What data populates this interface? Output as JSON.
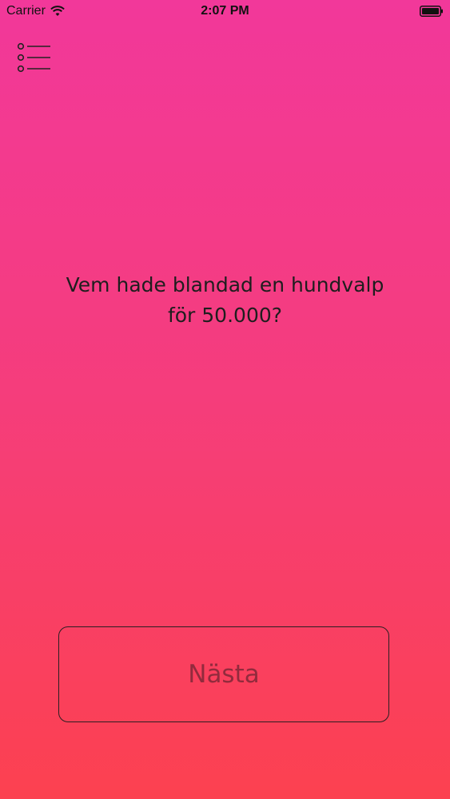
{
  "status_bar": {
    "carrier": "Carrier",
    "time": "2:07 PM",
    "wifi_icon": "wifi-icon",
    "battery_icon": "battery-icon"
  },
  "menu": {
    "icon": "list-menu-icon"
  },
  "question": {
    "line1": "Vem hade blandad en hundvalp",
    "line2": "för 50.000?"
  },
  "next_button": {
    "label": "Nästa"
  },
  "colors": {
    "gradient_top": "#f2389a",
    "gradient_bottom": "#fc4150",
    "text": "#1e1e1e"
  }
}
